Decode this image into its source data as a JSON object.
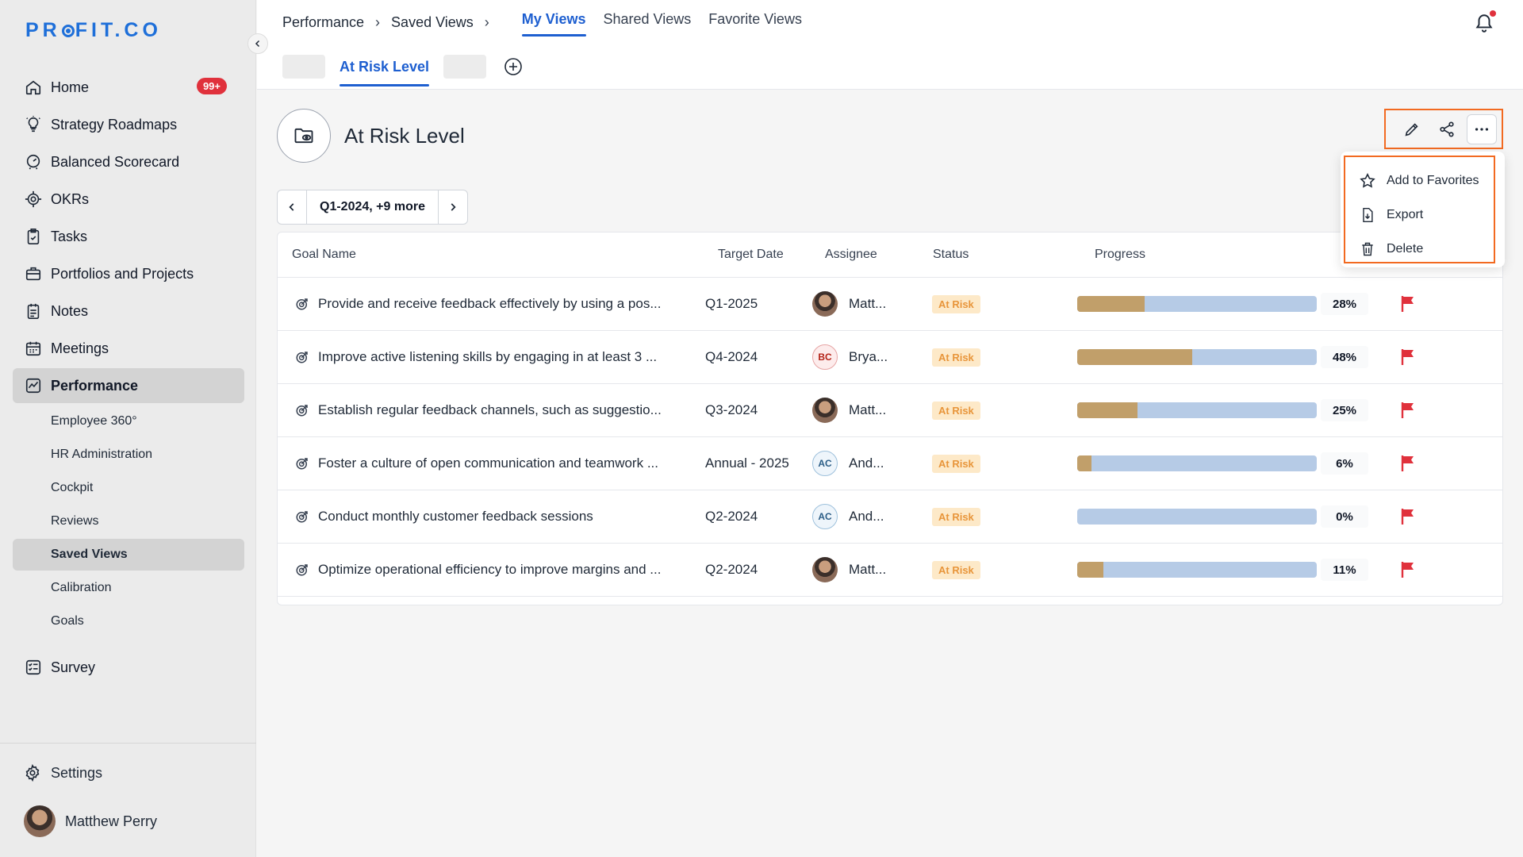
{
  "brand": {
    "logo_text_before": "PR",
    "logo_text_after": "FIT.CO"
  },
  "sidebar": {
    "items": [
      {
        "label": "Home",
        "icon": "home-icon",
        "badge": "99+"
      },
      {
        "label": "Strategy Roadmaps",
        "icon": "lightbulb-icon"
      },
      {
        "label": "Balanced Scorecard",
        "icon": "scorecard-icon"
      },
      {
        "label": "OKRs",
        "icon": "target-icon"
      },
      {
        "label": "Tasks",
        "icon": "clipboard-check-icon"
      },
      {
        "label": "Portfolios and Projects",
        "icon": "briefcase-icon"
      },
      {
        "label": "Notes",
        "icon": "notes-icon"
      },
      {
        "label": "Meetings",
        "icon": "calendar-icon"
      },
      {
        "label": "Performance",
        "icon": "performance-icon"
      }
    ],
    "performance_sub": [
      "Employee 360°",
      "HR Administration",
      "Cockpit",
      "Reviews",
      "Saved Views",
      "Calibration",
      "Goals"
    ],
    "survey": {
      "label": "Survey",
      "icon": "survey-icon"
    },
    "settings": {
      "label": "Settings",
      "icon": "gear-icon"
    },
    "user": {
      "name": "Matthew Perry"
    }
  },
  "breadcrumb": {
    "items": [
      "Performance",
      "Saved Views"
    ]
  },
  "view_tabs": [
    "My Views",
    "Shared Views",
    "Favorite Views"
  ],
  "subtab": {
    "label": "At Risk Level"
  },
  "view": {
    "title": "At Risk Level",
    "period": "Q1-2024, +9 more"
  },
  "dropdown": {
    "items": [
      "Add to Favorites",
      "Export",
      "Delete"
    ]
  },
  "table": {
    "headers": [
      "Goal Name",
      "Target Date",
      "Assignee",
      "Status",
      "Progress"
    ],
    "rows": [
      {
        "name": "Provide and receive feedback effectively by using a pos...",
        "date": "Q1-2025",
        "assignee": "Matt...",
        "avatar": "photo",
        "initials": "",
        "status": "At Risk",
        "progress": 28,
        "progress_label": "28%"
      },
      {
        "name": "Improve active listening skills by engaging in at least 3 ...",
        "date": "Q4-2024",
        "assignee": "Brya...",
        "avatar": "bc",
        "initials": "BC",
        "status": "At Risk",
        "progress": 48,
        "progress_label": "48%"
      },
      {
        "name": "Establish regular feedback channels, such as suggestio...",
        "date": "Q3-2024",
        "assignee": "Matt...",
        "avatar": "photo",
        "initials": "",
        "status": "At Risk",
        "progress": 25,
        "progress_label": "25%"
      },
      {
        "name": "Foster a culture of open communication and teamwork ...",
        "date": "Annual - 2025",
        "assignee": "And...",
        "avatar": "ac",
        "initials": "AC",
        "status": "At Risk",
        "progress": 6,
        "progress_label": "6%"
      },
      {
        "name": "Conduct monthly customer feedback sessions",
        "date": "Q2-2024",
        "assignee": "And...",
        "avatar": "ac",
        "initials": "AC",
        "status": "At Risk",
        "progress": 0,
        "progress_label": "0%"
      },
      {
        "name": "Optimize operational efficiency to improve margins and ...",
        "date": "Q2-2024",
        "assignee": "Matt...",
        "avatar": "photo",
        "initials": "",
        "status": "At Risk",
        "progress": 11,
        "progress_label": "11%"
      }
    ]
  },
  "colors": {
    "accent": "#1e5fd0",
    "highlight": "#f26a21",
    "progress_fill": "#c19f6a",
    "progress_track": "#b6cbe6",
    "flag": "#e0313c",
    "status_bg": "#fde9c8",
    "status_text": "#e8953a"
  }
}
